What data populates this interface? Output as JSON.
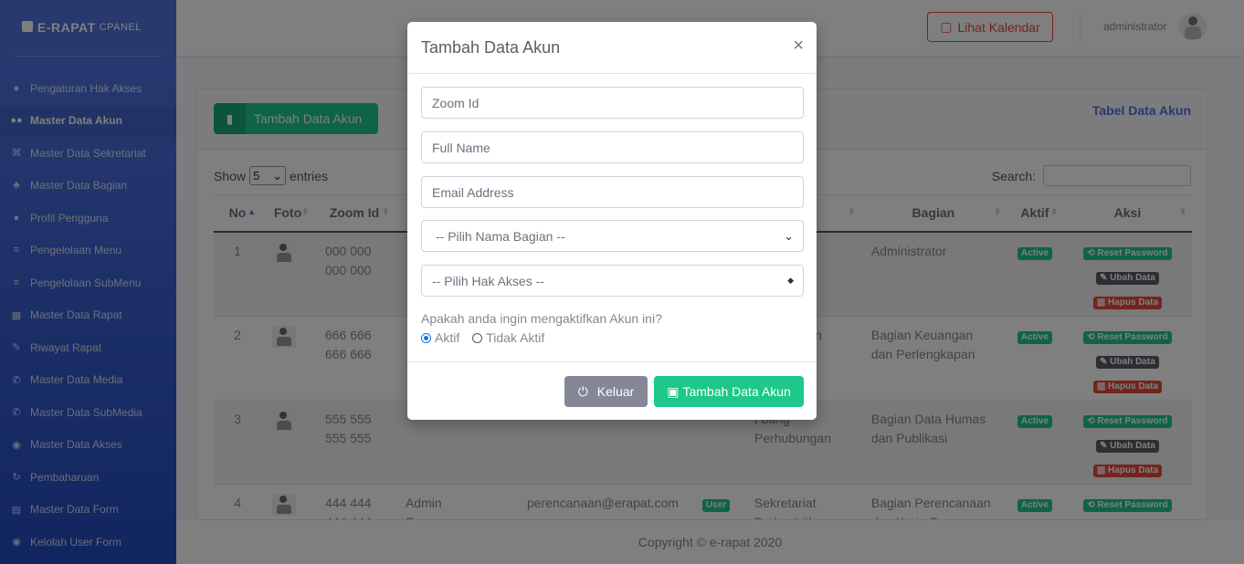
{
  "brand": {
    "title": "E-RAPAT",
    "subtitle": "CPANEL"
  },
  "sidebar": {
    "items": [
      {
        "label": "Pengaturan Hak Akses",
        "icon": "user-icon"
      },
      {
        "label": "Master Data Akun",
        "icon": "users-icon",
        "active": true
      },
      {
        "label": "Master Data Sekretariat",
        "icon": "sitemap-icon"
      },
      {
        "label": "Master Data Bagian",
        "icon": "org-icon"
      },
      {
        "label": "Profil Pengguna",
        "icon": "user-icon"
      },
      {
        "label": "Pengelolaan Menu",
        "icon": "menu-icon"
      },
      {
        "label": "Pengelolaan SubMenu",
        "icon": "menu-icon"
      },
      {
        "label": "Master Data Rapat",
        "icon": "calendar-icon"
      },
      {
        "label": "Riwayat Rapat",
        "icon": "edit-icon"
      },
      {
        "label": "Master Data Media",
        "icon": "phone-icon"
      },
      {
        "label": "Master Data SubMedia",
        "icon": "phone-icon"
      },
      {
        "label": "Master Data Akses",
        "icon": "user-circle-icon"
      },
      {
        "label": "Pembaharuan",
        "icon": "sync-icon"
      },
      {
        "label": "Master Data Form",
        "icon": "file-icon"
      },
      {
        "label": "Kelolah User Form",
        "icon": "user-circle-icon"
      }
    ]
  },
  "topbar": {
    "calendar_label": "Lihat Kalendar",
    "user": "administrator"
  },
  "card": {
    "add_button": "Tambah Data Akun",
    "title": "Tabel Data Akun",
    "show_label": "Show",
    "show_value": "5",
    "entries_label": "entries",
    "search_label": "Search:"
  },
  "table": {
    "headers": [
      "No",
      "Foto",
      "Zoom Id",
      "",
      "",
      "",
      "riat",
      "Bagian",
      "Aktif",
      "Aksi"
    ],
    "rows": [
      {
        "no": "1",
        "zoom": "000 000 000 000",
        "name": "",
        "email": "",
        "role": "",
        "sekretariat": "min",
        "bagian": "Administrator",
        "aktif": "Active"
      },
      {
        "no": "2",
        "zoom": "666 666 666 666",
        "name": "",
        "email": "",
        "role": "",
        "sekretariat": "t bang ngan",
        "bagian": "Bagian Keuangan dan Perlengkapan",
        "aktif": "Active"
      },
      {
        "no": "3",
        "zoom": "555 555 555 555",
        "name": "",
        "email": "",
        "role": "",
        "sekretariat": "t bang Perhubungan",
        "bagian": "Bagian Data Humas dan Publikasi",
        "aktif": "Active"
      },
      {
        "no": "4",
        "zoom": "444 444 444 444",
        "name": "Admin Perencanaan",
        "email": "perencanaan@erapat.com",
        "role": "User",
        "sekretariat": "Sekretariat Badan Litbang Perhubungan",
        "bagian": "Bagian Perencanaan dan Kerja Sama",
        "aktif": "Active"
      }
    ],
    "actions": {
      "reset": "Reset Password",
      "edit": "Ubah Data",
      "delete": "Hapus Data"
    }
  },
  "footer": {
    "text": "Copyright © e-rapat 2020"
  },
  "modal": {
    "title": "Tambah Data Akun",
    "close": "×",
    "zoom_placeholder": "Zoom Id",
    "name_placeholder": "Full Name",
    "email_placeholder": "Email Address",
    "bagian_select": "-- Pilih Nama Bagian --",
    "akses_select": "-- Pilih Hak Akses --",
    "question": "Apakah anda ingin mengaktifkan Akun ini?",
    "radio_active": "Aktif",
    "radio_inactive": "Tidak Aktif",
    "cancel_button": "Keluar",
    "submit_button": "Tambah Data Akun"
  }
}
